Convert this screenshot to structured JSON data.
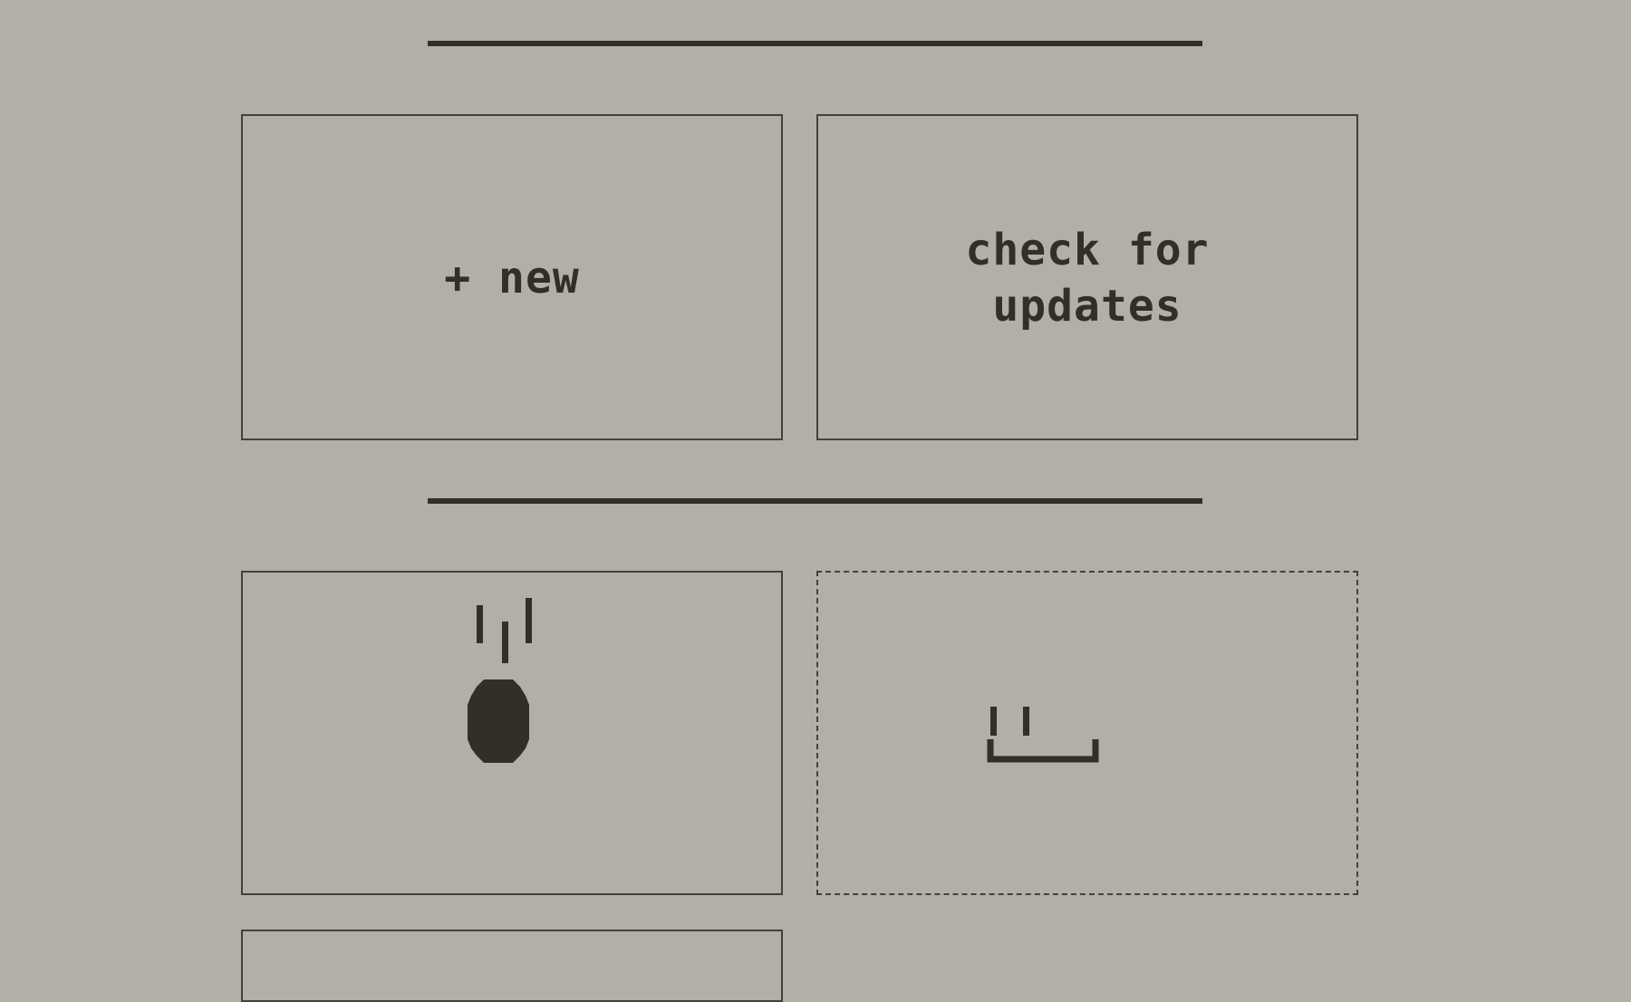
{
  "actions": {
    "new_label": "+ new",
    "update_label": "check for\nupdates"
  },
  "slots": {
    "first_icon": "steaming-blob-icon",
    "second_icon": "empty-bracket-icon",
    "second_style": "dashed"
  },
  "colors": {
    "background": "#b2afa6",
    "ink": "#322e28",
    "border": "#45413a"
  }
}
